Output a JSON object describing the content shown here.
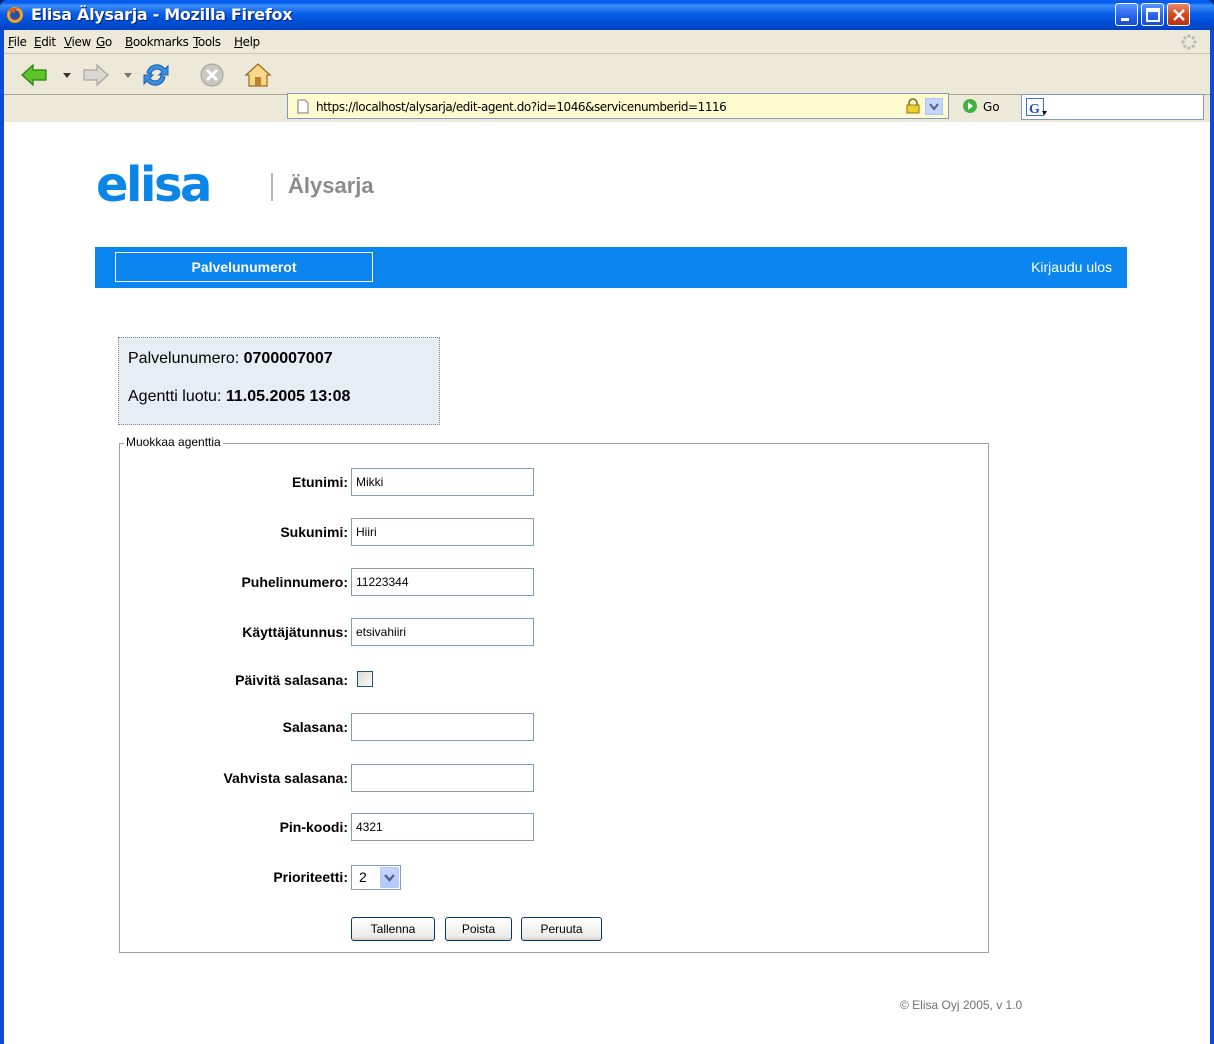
{
  "window": {
    "title": "Elisa Älysarja - Mozilla Firefox"
  },
  "menu": {
    "items": [
      "File",
      "Edit",
      "View",
      "Go",
      "Bookmarks",
      "Tools",
      "Help"
    ]
  },
  "toolbar": {
    "url": "https://localhost/alysarja/edit-agent.do?id=1046&servicenumberid=1116",
    "go_label": "Go"
  },
  "header": {
    "logo": "elisa",
    "app_name": "Älysarja"
  },
  "nav": {
    "tab_label": "Palvelunumerot",
    "logout_label": "Kirjaudu ulos"
  },
  "info": {
    "service_number_label": "Palvelunumero:",
    "service_number": "0700007007",
    "created_label": "Agentti luotu:",
    "created_at": "11.05.2005 13:08"
  },
  "form": {
    "legend": "Muokkaa agenttia",
    "first_name_label": "Etunimi:",
    "first_name": "Mikki",
    "last_name_label": "Sukunimi:",
    "last_name": "Hiiri",
    "phone_label": "Puhelinnumero:",
    "phone": "11223344",
    "username_label": "Käyttäjätunnus:",
    "username": "etsivahiiri",
    "update_password_label": "Päivitä salasana:",
    "password_label": "Salasana:",
    "password": "",
    "confirm_password_label": "Vahvista salasana:",
    "confirm_password": "",
    "pin_label": "Pin-koodi:",
    "pin": "4321",
    "priority_label": "Prioriteetti:",
    "priority": "2",
    "save_label": "Tallenna",
    "delete_label": "Poista",
    "cancel_label": "Peruuta"
  },
  "footer": {
    "copyright": "© Elisa Oyj 2005, v 1.0"
  },
  "colors": {
    "brand_blue": "#0b86f0",
    "info_bg": "#e6edf4",
    "window_blue": "#0a4ed8"
  }
}
